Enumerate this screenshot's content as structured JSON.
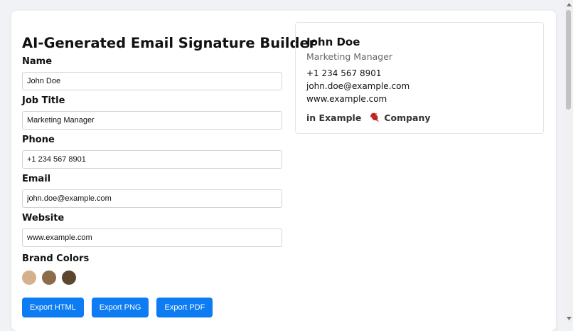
{
  "builder": {
    "title": "AI-Generated Email Signature Builder",
    "fields": [
      {
        "label": "Name",
        "value": "John Doe"
      },
      {
        "label": "Job Title",
        "value": "Marketing Manager"
      },
      {
        "label": "Phone",
        "value": "+1 234 567 8901"
      },
      {
        "label": "Email",
        "value": "john.doe@example.com"
      },
      {
        "label": "Website",
        "value": "www.example.com"
      }
    ],
    "brand_colors_label": "Brand Colors",
    "brand_colors": [
      "#d4b08c",
      "#8b6b4a",
      "#5c4630"
    ],
    "buttons": {
      "export_html": "Export HTML",
      "export_png": "Export PNG",
      "export_pdf": "Export PDF"
    }
  },
  "preview": {
    "name": "John Doe",
    "job_title": "Marketing Manager",
    "phone": "+1 234 567 8901",
    "email": "john.doe@example.com",
    "website": "www.example.com",
    "social_prefix": "in Example",
    "company": "Company",
    "company_icon": "red-bird-icon"
  }
}
